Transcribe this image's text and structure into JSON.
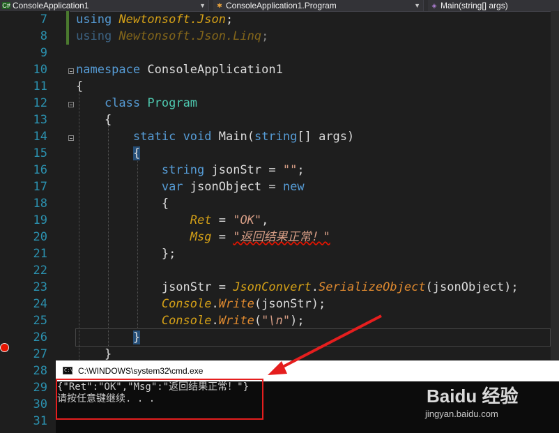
{
  "nav": {
    "project": "ConsoleApplication1",
    "class": "ConsoleApplication1.Program",
    "member": "Main(string[] args)",
    "project_icon": "C#",
    "class_icon": "class-icon",
    "member_icon": "method-icon"
  },
  "code": {
    "line_numbers": [
      "7",
      "8",
      "9",
      "10",
      "11",
      "12",
      "13",
      "14",
      "15",
      "16",
      "17",
      "18",
      "19",
      "20",
      "21",
      "22",
      "23",
      "24",
      "25",
      "26",
      "27",
      "28",
      "29",
      "30",
      "31"
    ],
    "l7": {
      "kw": "using",
      "ns": "Newtonsoft.Json",
      "end": ";"
    },
    "l8": {
      "kw": "using",
      "ns": "Newtonsoft.Json.Linq",
      "end": ";"
    },
    "l10": {
      "kw": "namespace",
      "name": "ConsoleApplication1"
    },
    "l11": "{",
    "l12": {
      "kw": "class",
      "name": "Program"
    },
    "l13": "{",
    "l14": {
      "kw1": "static",
      "kw2": "void",
      "name": "Main(",
      "type": "string",
      "rest": "[] args)"
    },
    "l15": "{",
    "l16": {
      "type": "string",
      "var": " jsonStr = ",
      "str": "\"\"",
      "end": ";"
    },
    "l17": {
      "kw": "var",
      "var": " jsonObject = ",
      "kw2": "new"
    },
    "l18": "{",
    "l19": {
      "prop": "Ret",
      "eq": " = ",
      "str": "\"OK\"",
      "end": ","
    },
    "l20": {
      "prop": "Msg",
      "eq": " = ",
      "str": "\"返回结果正常！\""
    },
    "l21": "};",
    "l23": {
      "var": "jsonStr = ",
      "cls": "JsonConvert",
      "dot": ".",
      "method": "SerializeObject",
      "args": "(jsonObject);"
    },
    "l24": {
      "cls": "Console",
      "dot": ".",
      "method": "Write",
      "args": "(jsonStr);"
    },
    "l25": {
      "cls": "Console",
      "dot": ".",
      "method": "Write",
      "open": "(",
      "str": "\"\\n\"",
      "close": ");"
    },
    "l26": "}",
    "l27": "}"
  },
  "cmd": {
    "title": "C:\\WINDOWS\\system32\\cmd.exe",
    "icon_text": "C:\\",
    "output_line1": "{\"Ret\":\"OK\",\"Msg\":\"返回结果正常！\"}",
    "output_line2": "请按任意键继续. . ."
  },
  "watermark": {
    "logo": "Baidu 经验",
    "url": "jingyan.baidu.com"
  },
  "colors": {
    "annotation_red": "#e51e1e",
    "editor_bg": "#1e1e1e",
    "line_number": "#2b91af",
    "keyword": "#569cd6",
    "type": "#4ec9b0",
    "string": "#d69d85"
  }
}
